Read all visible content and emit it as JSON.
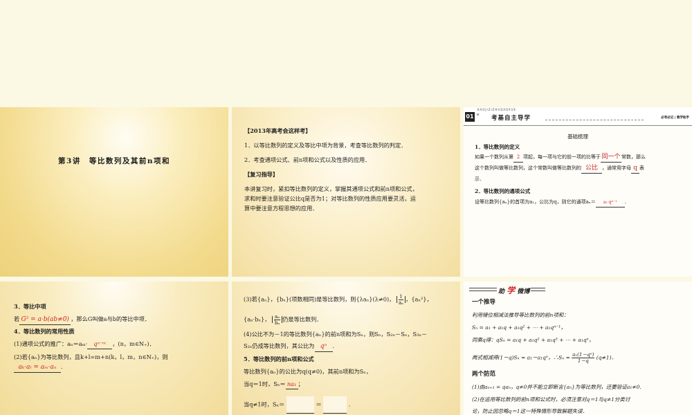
{
  "slide1": {
    "title": "第3讲　等比数列及其前n项和"
  },
  "slide2": {
    "exam_heading": "【2013年高考会这样考】",
    "exam_item1": "1．以等比数列的定义及等比中项为背景，考查等比数列的判定．",
    "exam_item2": "2．考查通项公式、前n项和公式以及性质的应用．",
    "review_heading": "【复习指导】",
    "review_line1": "本讲复习时，紧扣等比数列的定义，掌握其通项公式和前n项和公式，",
    "review_line2": "求和时要注意验证公比q是否为1；对等比数列的性质应用要灵活，运",
    "review_line3": "算中要注意方程思想的应用．"
  },
  "slide3": {
    "header_num": "01",
    "header_arrow": "»",
    "header_pinyin": "KAOJIZIZHUDAOXUE",
    "header_title": "考基自主导学",
    "header_right": "必考必记 | 教学助手",
    "section_title": "基础梳理",
    "def_heading": "1．等比数列的定义",
    "def_line1_a": "如果一个数列从第",
    "def_fill1": "2",
    "def_line1_b": "项起，每一项与它的前一项的比等于",
    "def_fill2": "同一个",
    "def_line1_c": "常数，那么",
    "def_line2_a": "这个数列叫做等比数列，这个常数叫做等比数列的",
    "def_fill3": "公比",
    "def_line2_b": "，通常用字母",
    "def_fill4": "q",
    "def_line2_c": "表",
    "def_line3": "示．",
    "formula_heading": "2．等比数列的通项公式",
    "formula_line_a": "设等比数列{aₙ}的首项为a₁，公比为q，则它的通项aₙ＝",
    "formula_fill": "a₁·qⁿ⁻¹",
    "formula_line_b": "."
  },
  "slide4": {
    "mid_heading": "3．等比中项",
    "mid_a": "若",
    "mid_fill": "G² = a·b(ab≠0)",
    "mid_b": "，那么G叫做a与b的等比中项．",
    "prop_heading": "4．等比数列的常用性质",
    "prop1_a": "(1)通项公式的推广：aₙ＝aₘ·",
    "prop1_fill": "qⁿ⁻ᵐ",
    "prop1_b": "，(n，m∈N₊)．",
    "prop2_a": "(2)若{aₙ}为等比数列，且k+l=m+n(k，l，m，n∈N₊)，则",
    "prop2_fill": "aₖ·aₗ = aₘ·aₙ",
    "prop2_b": "."
  },
  "slide5": {
    "p3_a": "(3)若{aₙ}，{bₙ}(项数相同)是等比数列，则{λaₙ}(λ≠0)，",
    "p3_frac_num": "1",
    "p3_frac_den": "aₙ",
    "p3_b": "，{aₙ²}，",
    "p3_c": "{aₙ·bₙ}，",
    "p3_frac2_num": "aₙ",
    "p3_frac2_den": "bₙ",
    "p3_d": "仍是等比数列．",
    "p4_a": "(4)公比不为－1的等比数列{aₙ}的前n项和为Sₙ，则Sₙ，S₂ₙ－Sₙ，S₃ₙ－",
    "p4_b": "S₂ₙ仍成等比数列，其公比为",
    "p4_fill": "qⁿ",
    "p4_c": ".",
    "sum_heading": "5．等比数列的前n项和公式",
    "sum_line1": "等比数列{aₙ}的公比为q(q≠0)，其前n项和为Sₙ，",
    "sum_line2_a": "当q＝1时，Sₙ＝",
    "sum_line2_fill": "na₁",
    "sum_line2_b": "；",
    "sum_line3_a": "当q≠1时，Sₙ＝",
    "sum_line3_eq": "＝",
    "sum_line3_end": "."
  },
  "slide6": {
    "banner": "助学微博",
    "banner_em": "学",
    "banner_left": "助",
    "banner_right": "微博",
    "derive_heading": "一个推导",
    "derive_line1": "利用错位相减法推导等比数列的前n项和：",
    "derive_line2": "Sₙ = a₁ + a₁q + a₁q² + ⋯ + a₁qⁿ⁻¹，",
    "derive_line3": "同乘q得：qSₙ = a₁q + a₁q² + a₁q³ + ⋯ + a₁qⁿ，",
    "derive_line4_a": "两式相减得(1－q)Sₙ = a₁－a₁qⁿ，∴Sₙ =",
    "derive_frac_num": "a₁(1－qⁿ)",
    "derive_frac_den": "1－q",
    "derive_line4_b": "(q≠1)．",
    "pitfall_heading": "两个防范",
    "pitfall1": "(1)由aₙ₊₁ = qaₙ，q≠0并不能立即断言{aₙ}为等比数列，还要验证a₁≠0.",
    "pitfall2": "(2)在运用等比数列的前n项和公式时，必须注意对q＝1与q≠1分类讨",
    "pitfall3": "论，防止因忽略q＝1这一特殊情形导致解题失误．"
  }
}
